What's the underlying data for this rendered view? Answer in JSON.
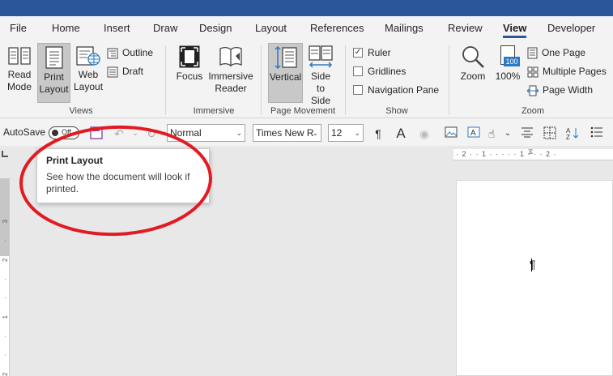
{
  "tabs": [
    "File",
    "Home",
    "Insert",
    "Draw",
    "Design",
    "Layout",
    "References",
    "Mailings",
    "Review",
    "View",
    "Developer"
  ],
  "active_tab": "View",
  "ribbon": {
    "views": {
      "label": "Views",
      "read_mode": "Read Mode",
      "print_layout": "Print Layout",
      "web_layout": "Web Layout",
      "outline": "Outline",
      "draft": "Draft"
    },
    "immersive": {
      "label": "Immersive",
      "focus": "Focus",
      "immersive_reader": "Immersive Reader"
    },
    "page_movement": {
      "label": "Page Movement",
      "vertical": "Vertical",
      "side_to_side": "Side to Side"
    },
    "show": {
      "label": "Show",
      "ruler": "Ruler",
      "ruler_checked": true,
      "gridlines": "Gridlines",
      "navigation_pane": "Navigation Pane"
    },
    "zoom": {
      "label": "Zoom",
      "zoom": "Zoom",
      "zoom_100": "100%",
      "one_page": "One Page",
      "multiple_pages": "Multiple Pages",
      "page_width": "Page Width",
      "icon_100": "100"
    }
  },
  "qat": {
    "autosave": "AutoSave",
    "autosave_state": "Off",
    "style": "Normal",
    "font": "Times New R",
    "size": "12"
  },
  "ruler": {
    "ticks": "· 2 · · 1 · · · · · 1 · · · 2 ·",
    "vticks": "2 · · 1 · · 2 · 3"
  },
  "tooltip": {
    "title": "Print Layout",
    "description": "See how the document will look if printed."
  },
  "colors": {
    "accent": "#2b579a",
    "annotation": "#e21b23"
  }
}
